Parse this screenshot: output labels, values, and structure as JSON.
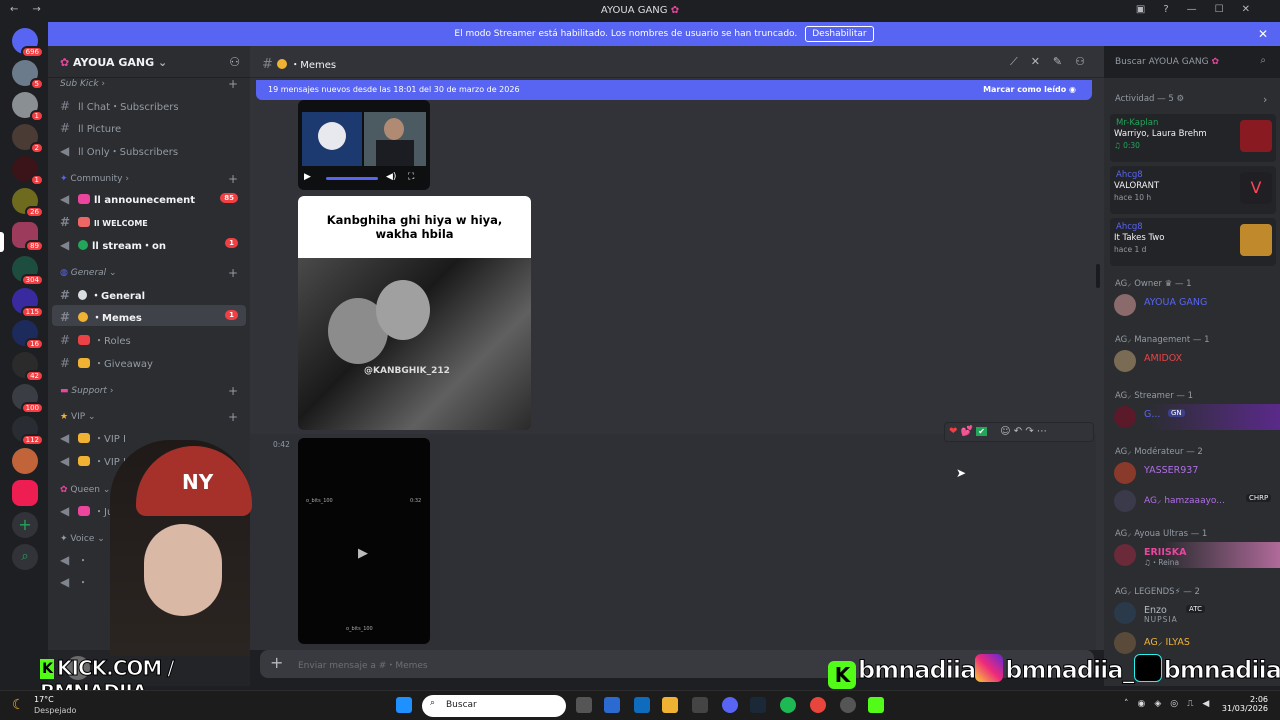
{
  "window": {
    "title": "AYOUA GANG",
    "back": "←",
    "forward": "→",
    "controls": [
      "▣",
      "?",
      "—",
      "☐",
      "✕"
    ]
  },
  "banner": {
    "text": "El modo Streamer está habilitado. Los nombres de usuario se han truncado.",
    "button": "Deshabilitar",
    "close": "✕"
  },
  "servers": {
    "badges": [
      "696",
      "5",
      "1",
      "2",
      "1",
      "26",
      "89",
      "304",
      "115",
      "16",
      "42",
      "100",
      "112"
    ],
    "add": "+",
    "discover": "⌕"
  },
  "guild": {
    "name": "AYOUA GANG",
    "categories": {
      "subkick": "Sub Kick",
      "community": "Community",
      "general": "General",
      "support": "Support",
      "vip": "VIP",
      "queen": "Queen",
      "voice": "Voice"
    },
    "channels": {
      "chat_subs": "ll Chat・Subscribers",
      "picture": "ll Picture",
      "only_subs": "ll Only・Subscribers",
      "announcement": "ll announecement",
      "announcement_count": "85",
      "welcome": "ll WELCOME",
      "stream": "ll stream・on",
      "stream_count": "1",
      "general": "・General",
      "memes": "・Memes",
      "memes_count": "1",
      "roles": "・Roles",
      "giveaway": "・Giveaway",
      "vip1": "・VIP Ⅰ",
      "vip2": "・VIP ⅠⅠ",
      "just": "・Just",
      "voice_a": "・",
      "voice_b": "・"
    }
  },
  "channel_header": {
    "name": "・Memes"
  },
  "new_messages": {
    "text": "19 mensajes nuevos desde las 18:01 del 30 de marzo de 2026",
    "mark_read": "Marcar como leído"
  },
  "messages": {
    "video_timestamp": "0:42",
    "meme_caption": "Kanbghiha ghi hiya w hiya, wakha hbila",
    "meme_watermark": "@KANBGHIK_212",
    "video_overlay_user": "o_bits_100",
    "video_overlay_time": "0:32",
    "video_overlay_footer": "o_bits_100",
    "reactions": [
      "❤",
      "💕",
      "✔"
    ]
  },
  "composer": {
    "placeholder": "Enviar mensaje a #・Memes",
    "plus": "+"
  },
  "search": {
    "placeholder": "Buscar AYOUA GANG"
  },
  "activity": {
    "header": "Actividad — 5",
    "items": [
      {
        "name": "Mr-Kaplan",
        "line1": "Warriyo, Laura Brehm",
        "line2": "♫ 0:30",
        "name_color": "#23a55a"
      },
      {
        "name": "Ahcg8",
        "line1": "VALORANT",
        "line2": "hace 10 h",
        "name_color": "#5865f2"
      },
      {
        "name": "Ahcg8",
        "line1": "It Takes Two",
        "line2": "hace 1 d",
        "name_color": "#5865f2"
      }
    ]
  },
  "member_sections": [
    {
      "label": "AG⸝ Owner ♛ — 1",
      "members": [
        {
          "name": "AYOUA GANG",
          "color": "#5865f2"
        }
      ]
    },
    {
      "label": "AG⸝ Management — 1",
      "members": [
        {
          "name": "AMIDOX",
          "color": "#ed4245"
        }
      ]
    },
    {
      "label": "AG⸝ Streamer — 1",
      "members": [
        {
          "name": "G...",
          "color": "#5865f2",
          "tag": "GN"
        }
      ]
    },
    {
      "label": "AG⸝ Modérateur — 2",
      "members": [
        {
          "name": "YASSER937",
          "color": "#b16ee8"
        },
        {
          "name": "AG⸝ hamzaaayo...",
          "color": "#b16ee8",
          "tag": "CHRP"
        }
      ]
    },
    {
      "label": "AG⸝ Ayoua Ultras — 1",
      "members": [
        {
          "name": "ERIISKA",
          "color": "#eb459e",
          "sub": "♫・Reina"
        }
      ]
    },
    {
      "label": "AG⸝ LEGENDS⚡ — 2",
      "members": [
        {
          "name": "Enzo",
          "color": "#b5bac1",
          "sub": "NUPSIA",
          "tag": "ATC"
        },
        {
          "name": "AG⸝ ILYAS",
          "color": "#f0b232"
        }
      ]
    }
  ],
  "overlay": {
    "kick": "KICK.COM / BMNADIIA",
    "kick_logo": "K",
    "handles": [
      "bmnadiia",
      "bmnadiia_",
      "bmnadiia"
    ],
    "logo_k": "K"
  },
  "taskbar": {
    "temp": "17°C",
    "weather": "Despejado",
    "search": "Buscar",
    "time": "2:06",
    "date": "31/03/2026"
  }
}
